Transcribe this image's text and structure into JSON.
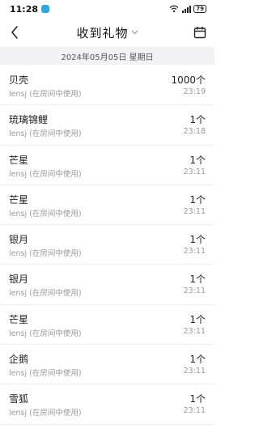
{
  "status": {
    "time": "11:28",
    "battery": "79"
  },
  "header": {
    "title": "收到礼物"
  },
  "date_label": "2024年05月05日 星期日",
  "gifts": [
    {
      "name": "贝壳",
      "sub": "lensj (在房间中使用)",
      "count": "1000个",
      "time": "23:19"
    },
    {
      "name": "琉璃锦鲤",
      "sub": "lensj (在房间中使用)",
      "count": "1个",
      "time": "23:18"
    },
    {
      "name": "芒星",
      "sub": "lensj (在房间中使用)",
      "count": "1个",
      "time": "23:11"
    },
    {
      "name": "芒星",
      "sub": "lensj (在房间中使用)",
      "count": "1个",
      "time": "23:11"
    },
    {
      "name": "银月",
      "sub": "lensj (在房间中使用)",
      "count": "1个",
      "time": "23:11"
    },
    {
      "name": "银月",
      "sub": "lensj (在房间中使用)",
      "count": "1个",
      "time": "23:11"
    },
    {
      "name": "芒星",
      "sub": "lensj (在房间中使用)",
      "count": "1个",
      "time": "23:11"
    },
    {
      "name": "企鹅",
      "sub": "lensj (在房间中使用)",
      "count": "1个",
      "time": "23:11"
    },
    {
      "name": "雪狐",
      "sub": "lensj (在房间中使用)",
      "count": "1个",
      "time": "23:11"
    }
  ]
}
